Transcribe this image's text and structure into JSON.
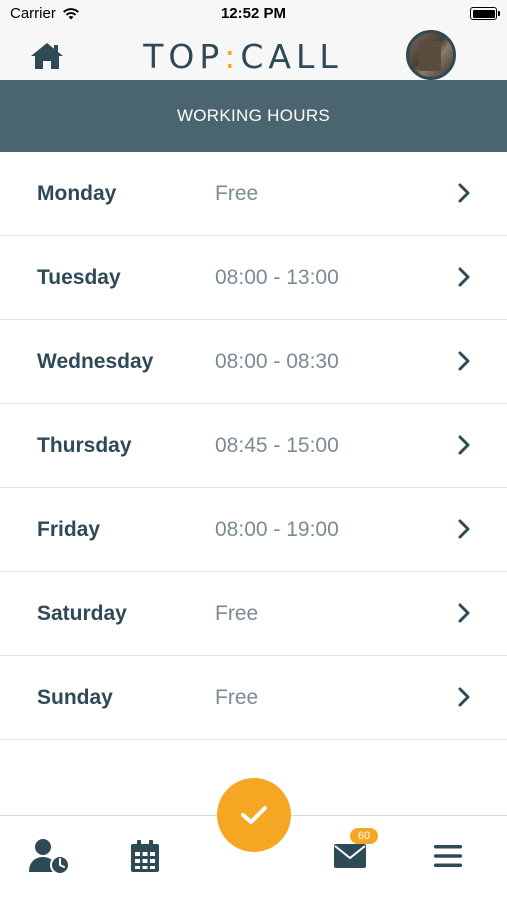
{
  "status_bar": {
    "carrier": "Carrier",
    "time": "12:52 PM"
  },
  "header": {
    "logo_left": "TOP",
    "logo_colon": ":",
    "logo_right": "CALL"
  },
  "page": {
    "title": "WORKING HOURS"
  },
  "days": [
    {
      "name": "Monday",
      "hours": "Free"
    },
    {
      "name": "Tuesday",
      "hours": "08:00 - 13:00"
    },
    {
      "name": "Wednesday",
      "hours": "08:00 - 08:30"
    },
    {
      "name": "Thursday",
      "hours": "08:45 - 15:00"
    },
    {
      "name": "Friday",
      "hours": "08:00 - 19:00"
    },
    {
      "name": "Saturday",
      "hours": "Free"
    },
    {
      "name": "Sunday",
      "hours": "Free"
    }
  ],
  "tab_bar": {
    "messages_badge": "60",
    "icons": [
      "user-clock-icon",
      "calendar-icon",
      "check-icon",
      "envelope-icon",
      "hamburger-menu-icon"
    ]
  },
  "colors": {
    "primary": "#2e4a56",
    "title_bar": "#4a6570",
    "accent": "#f5a623",
    "secondary_text": "#7a8c93"
  }
}
